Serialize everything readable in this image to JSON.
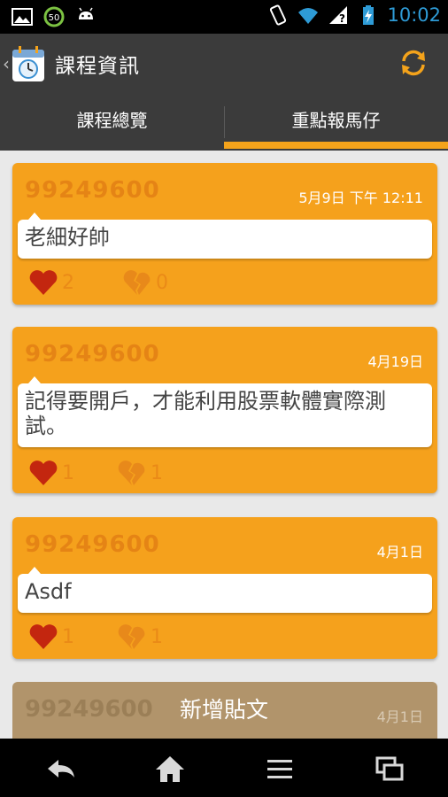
{
  "status_bar": {
    "time": "10:02",
    "icons": [
      "image-icon",
      "data-usage-icon",
      "android-icon",
      "vibrate-icon",
      "wifi-icon",
      "signal-icon",
      "battery-charging-icon"
    ]
  },
  "action_bar": {
    "title": "課程資訊",
    "app_icon": "calendar-clock-icon",
    "refresh_icon": "refresh-icon"
  },
  "tabs": [
    {
      "label": "課程總覽",
      "selected": false
    },
    {
      "label": "重點報馬仔",
      "selected": true
    }
  ],
  "colors": {
    "accent": "#f4a31b",
    "card": "#f5a11c",
    "heart": "#c3260f",
    "broken_heart": "#e8891a",
    "bar_bg": "#3b3b3b"
  },
  "posts": [
    {
      "user": "99249600",
      "date": "5月9日 下午 12:11",
      "content": "老細好帥",
      "likes": "2",
      "dislikes": "0"
    },
    {
      "user": "99249600",
      "date": "4月19日",
      "content": "記得要開戶，才能利用股票軟體實際測試。",
      "likes": "1",
      "dislikes": "1"
    },
    {
      "user": "99249600",
      "date": "4月1日",
      "content": "Asdf",
      "likes": "1",
      "dislikes": "1"
    },
    {
      "user": "99249600",
      "date": "4月1日"
    }
  ],
  "new_post_label": "新增貼文",
  "nav": [
    "back-icon",
    "home-icon",
    "menu-icon",
    "recent-apps-icon"
  ]
}
